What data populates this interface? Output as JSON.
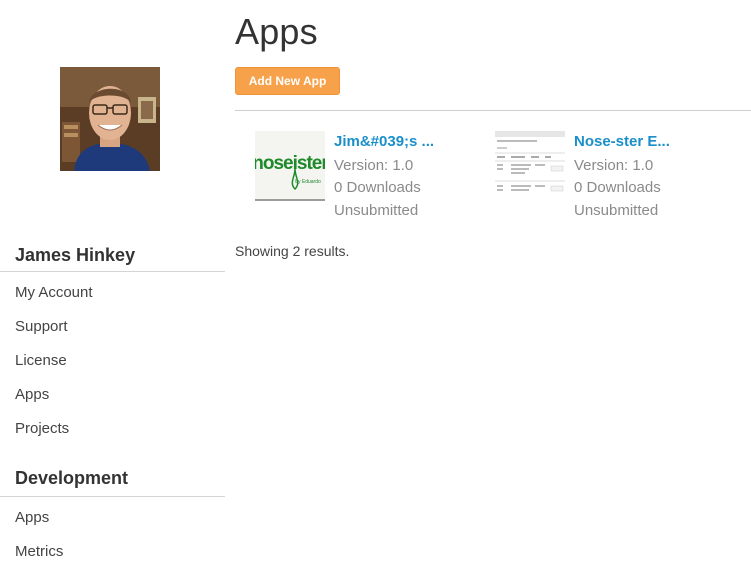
{
  "page": {
    "title": "Apps",
    "add_button": "Add New App",
    "results": "Showing 2 results."
  },
  "user": {
    "name": "James Hinkey"
  },
  "sidebar": {
    "account_items": [
      {
        "label": "My Account"
      },
      {
        "label": "Support"
      },
      {
        "label": "License"
      },
      {
        "label": "Apps"
      },
      {
        "label": "Projects"
      }
    ],
    "dev_heading": "Development",
    "dev_items": [
      {
        "label": "Apps"
      },
      {
        "label": "Metrics"
      }
    ]
  },
  "apps": [
    {
      "title": "Jim&#039;s ...",
      "version": "Version: 1.0",
      "downloads": "0 Downloads",
      "status": "Unsubmitted",
      "thumb_text": "noseister",
      "thumb_sub": "by Eduardo"
    },
    {
      "title": "Nose-ster E...",
      "version": "Version: 1.0",
      "downloads": "0 Downloads",
      "status": "Unsubmitted"
    }
  ],
  "colors": {
    "accent": "#f7a14a",
    "link": "#1a8fc9",
    "logo_green": "#1e8a2a"
  }
}
